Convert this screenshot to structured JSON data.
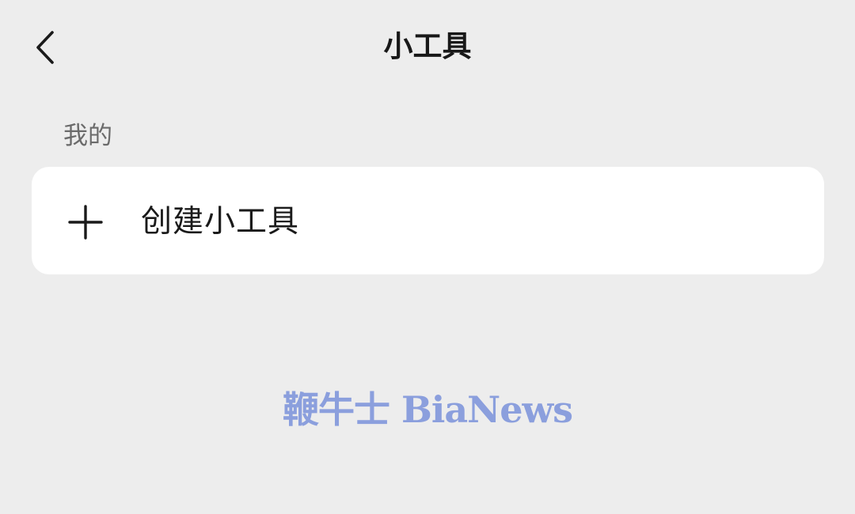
{
  "header": {
    "title": "小工具",
    "back_icon": "chevron-left-icon"
  },
  "section": {
    "label": "我的"
  },
  "card": {
    "icon": "plus-icon",
    "label": "创建小工具"
  },
  "watermark": {
    "text": "鞭牛士 BiaNews",
    "color": "#8b9fdd"
  },
  "colors": {
    "background": "#ededed",
    "card": "#ffffff",
    "text_primary": "#181818",
    "text_secondary": "#6b6b6b"
  }
}
